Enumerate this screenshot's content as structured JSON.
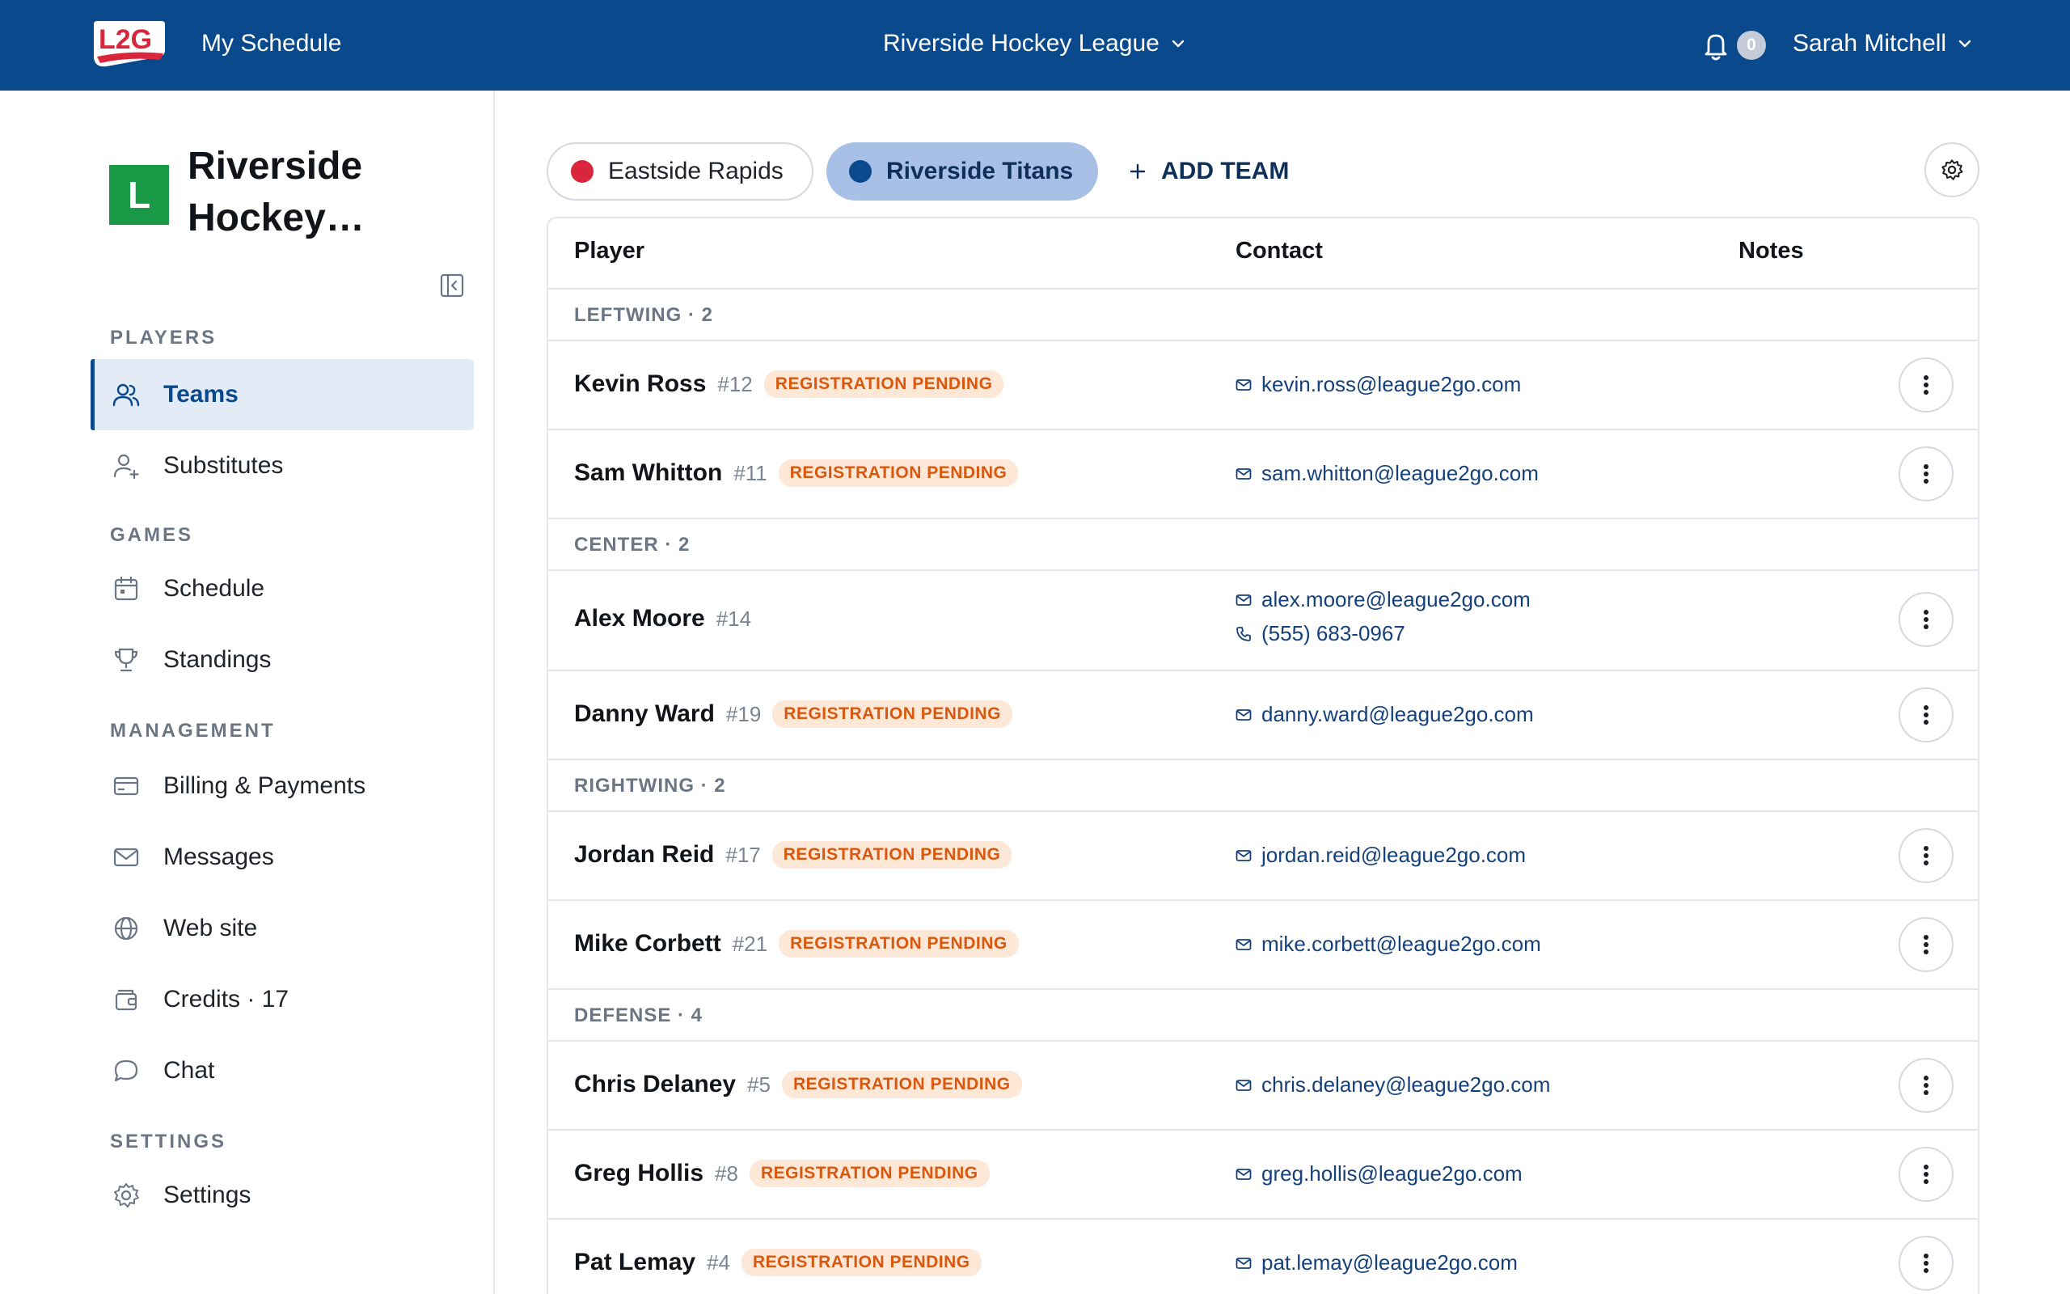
{
  "topbar": {
    "logo_text": "L2G",
    "my_schedule": "My Schedule",
    "league_name": "Riverside Hockey League",
    "notification_count": "0",
    "user_name": "Sarah Mitchell"
  },
  "sidebar": {
    "league_initial": "L",
    "league_name": "Riverside Hockey…",
    "sections": {
      "players": "PLAYERS",
      "games": "GAMES",
      "management": "MANAGEMENT",
      "settings": "SETTINGS"
    },
    "items": {
      "teams": "Teams",
      "substitutes": "Substitutes",
      "schedule": "Schedule",
      "standings": "Standings",
      "billing": "Billing & Payments",
      "messages": "Messages",
      "website": "Web site",
      "credits": "Credits · 17",
      "chat": "Chat",
      "settings": "Settings"
    },
    "active_item": "teams"
  },
  "teams": {
    "tabs": [
      {
        "name": "Eastside Rapids",
        "color": "#d9263d"
      },
      {
        "name": "Riverside Titans",
        "color": "#0a4a8c"
      }
    ],
    "selected": "Riverside Titans",
    "add_team_label": "ADD TEAM"
  },
  "table": {
    "headers": {
      "player": "Player",
      "contact": "Contact",
      "notes": "Notes"
    },
    "groups": [
      {
        "label": "LEFTWING · 2",
        "players": [
          {
            "name": "Kevin Ross",
            "number": "#12",
            "status": "REGISTRATION PENDING",
            "email": "kevin.ross@league2go.com"
          },
          {
            "name": "Sam Whitton",
            "number": "#11",
            "status": "REGISTRATION PENDING",
            "email": "sam.whitton@league2go.com"
          }
        ]
      },
      {
        "label": "CENTER · 2",
        "players": [
          {
            "name": "Alex Moore",
            "number": "#14",
            "email": "alex.moore@league2go.com",
            "phone": "(555) 683-0967"
          },
          {
            "name": "Danny Ward",
            "number": "#19",
            "status": "REGISTRATION PENDING",
            "email": "danny.ward@league2go.com"
          }
        ]
      },
      {
        "label": "RIGHTWING · 2",
        "players": [
          {
            "name": "Jordan Reid",
            "number": "#17",
            "status": "REGISTRATION PENDING",
            "email": "jordan.reid@league2go.com"
          },
          {
            "name": "Mike Corbett",
            "number": "#21",
            "status": "REGISTRATION PENDING",
            "email": "mike.corbett@league2go.com"
          }
        ]
      },
      {
        "label": "DEFENSE · 4",
        "players": [
          {
            "name": "Chris Delaney",
            "number": "#5",
            "status": "REGISTRATION PENDING",
            "email": "chris.delaney@league2go.com"
          },
          {
            "name": "Greg Hollis",
            "number": "#8",
            "status": "REGISTRATION PENDING",
            "email": "greg.hollis@league2go.com"
          },
          {
            "name": "Pat Lemay",
            "number": "#4",
            "status": "REGISTRATION PENDING",
            "email": "pat.lemay@league2go.com"
          }
        ]
      }
    ]
  }
}
